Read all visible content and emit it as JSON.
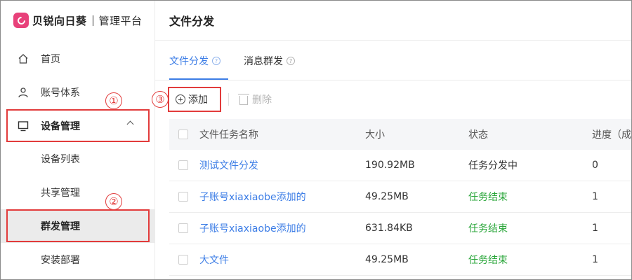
{
  "app": {
    "brand": "贝锐向日葵",
    "subtitle": "管理平台",
    "brand_color": "#e8417a",
    "accent_color": "#3c7de6",
    "success_color": "#2aa63a",
    "annotation_color": "#e23b3b"
  },
  "sidebar": {
    "items": [
      {
        "label": "首页",
        "icon": "home-icon"
      },
      {
        "label": "账号体系",
        "icon": "user-icon"
      },
      {
        "label": "设备管理",
        "icon": "monitor-icon",
        "expanded": true
      },
      {
        "label": "设备列表"
      },
      {
        "label": "共享管理"
      },
      {
        "label": "群发管理",
        "active": true
      },
      {
        "label": "安装部署"
      }
    ]
  },
  "annotations": [
    "①",
    "②",
    "③"
  ],
  "header": {
    "title": "文件分发"
  },
  "tabs": [
    {
      "label": "文件分发",
      "help": "?",
      "active": true
    },
    {
      "label": "消息群发",
      "help": "?"
    }
  ],
  "toolbar": {
    "add_label": "添加",
    "delete_label": "删除"
  },
  "table": {
    "columns": [
      "文件任务名称",
      "大小",
      "状态",
      "进度（成"
    ],
    "rows": [
      {
        "name": "测试文件分发",
        "size": "190.92MB",
        "status": "任务分发中",
        "progress": "0"
      },
      {
        "name": "子账号xiaxiaobe添加的",
        "size": "49.25MB",
        "status": "任务结束",
        "progress": "1"
      },
      {
        "name": "子账号xiaxiaobe添加的",
        "size": "631.84KB",
        "status": "任务结束",
        "progress": "1"
      },
      {
        "name": "大文件",
        "size": "49.25MB",
        "status": "任务结束",
        "progress": "1"
      }
    ]
  }
}
